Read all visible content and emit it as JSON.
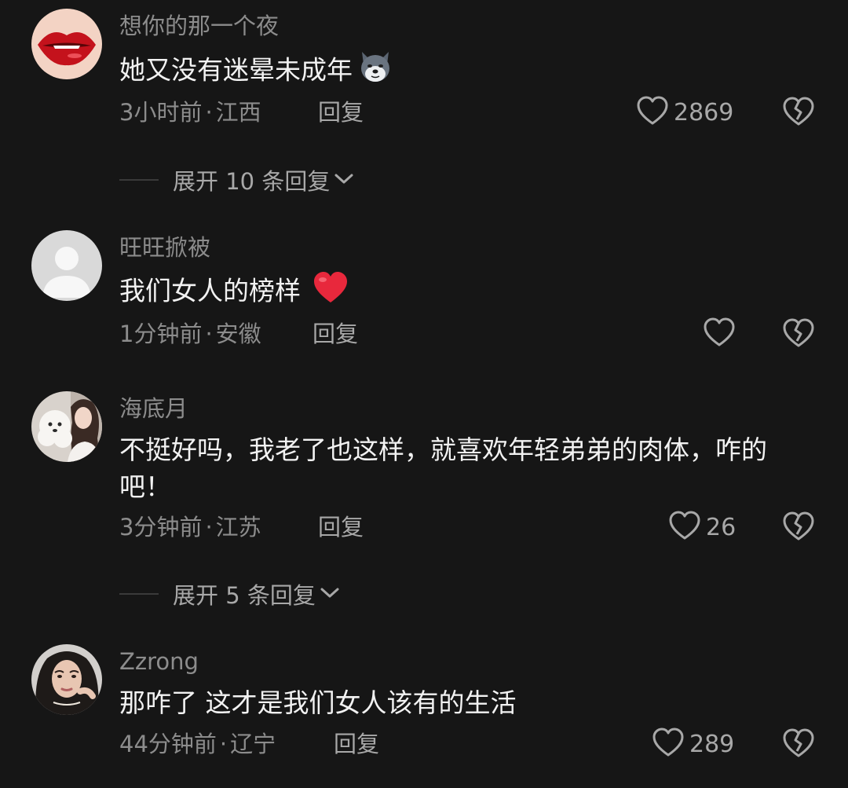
{
  "comments": [
    {
      "username": "想你的那一个夜",
      "text": "她又没有迷晕未成年",
      "emoji": "wolf-emoji",
      "time": "3小时前",
      "separator": "·",
      "location": "江西",
      "reply_label": "回复",
      "likes": "2869",
      "avatar": "red-lips-avatar"
    },
    {
      "username": "旺旺掀被",
      "text": "我们女人的榜样",
      "emoji": "red-heart-emoji",
      "time": "1分钟前",
      "separator": "·",
      "location": "安徽",
      "reply_label": "回复",
      "likes": "",
      "avatar": "default-person-avatar"
    },
    {
      "username": "海底月",
      "text": "不挺好吗，我老了也这样，就喜欢年轻弟弟的肉体，咋的吧！",
      "time": "3分钟前",
      "separator": "·",
      "location": "江苏",
      "reply_label": "回复",
      "likes": "26",
      "avatar": "girl-with-dog-avatar"
    },
    {
      "username": "Zzrong",
      "text": "那咋了 这才是我们女人该有的生活",
      "time": "44分钟前",
      "separator": "·",
      "location": "辽宁",
      "reply_label": "回复",
      "likes": "289",
      "avatar": "woman-portrait-avatar"
    }
  ],
  "expanders": [
    {
      "label": "展开 10 条回复"
    },
    {
      "label": "展开 5 条回复"
    }
  ],
  "colors": {
    "background": "#161616",
    "secondary_text": "#8c8c8c",
    "primary_text": "#f2f2f2",
    "heart_emoji": "#e8283c"
  }
}
